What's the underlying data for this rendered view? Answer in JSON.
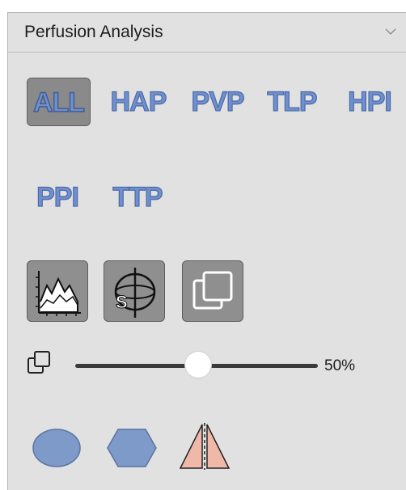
{
  "panel": {
    "title": "Perfusion Analysis",
    "collapse_icon": "chevron-down-icon"
  },
  "map_buttons": [
    {
      "label": "ALL",
      "active": true
    },
    {
      "label": "HAP",
      "active": false
    },
    {
      "label": "PVP",
      "active": false
    },
    {
      "label": "TLP",
      "active": false
    },
    {
      "label": "HPI",
      "active": false
    },
    {
      "label": "PPI",
      "active": false
    },
    {
      "label": "TTP",
      "active": false
    }
  ],
  "tools": [
    {
      "icon": "perfusion-curve-chart-icon"
    },
    {
      "icon": "sphere-roi-icon"
    },
    {
      "icon": "overlay-layers-icon"
    }
  ],
  "opacity": {
    "icon": "opacity-layers-icon",
    "value": 0.5,
    "label": "50%"
  },
  "roi_shapes": [
    {
      "icon": "ellipse-roi-icon"
    },
    {
      "icon": "hexagon-roi-icon"
    },
    {
      "icon": "mirror-roi-icon"
    }
  ],
  "colors": {
    "panel_bg": "#e1e1e1",
    "text_blue": "#6f8fd0",
    "button_gray": "#8f8f8f",
    "shape_blue": "#7e9ac9",
    "shape_pink": "#f0b8a8"
  }
}
